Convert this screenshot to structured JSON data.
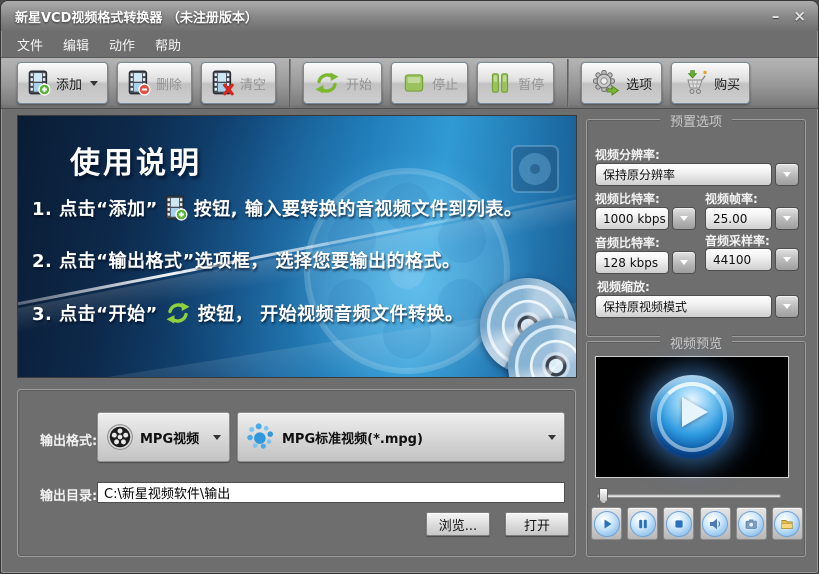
{
  "window": {
    "title": "新星VCD视频格式转换器 （未注册版本）",
    "minimize_glyph": "–",
    "close_glyph": "×"
  },
  "menu": {
    "items": [
      {
        "label": "文件"
      },
      {
        "label": "编辑"
      },
      {
        "label": "动作"
      },
      {
        "label": "帮助"
      }
    ]
  },
  "toolbar": {
    "buttons": [
      {
        "label": "添加",
        "icon": "film-add-icon",
        "enabled": true,
        "has_dropdown": true
      },
      {
        "label": "删除",
        "icon": "film-remove-icon",
        "enabled": false
      },
      {
        "label": "清空",
        "icon": "film-clear-icon",
        "enabled": false
      },
      {
        "label": "开始",
        "icon": "refresh-arrows-icon",
        "enabled": false
      },
      {
        "label": "停止",
        "icon": "stop-square-icon",
        "enabled": false
      },
      {
        "label": "暂停",
        "icon": "pause-bars-icon",
        "enabled": false
      },
      {
        "label": "选项",
        "icon": "gear-icon",
        "enabled": true
      },
      {
        "label": "购买",
        "icon": "shopping-cart-icon",
        "enabled": true
      }
    ]
  },
  "instructions": {
    "title": "使用说明",
    "steps": [
      {
        "pre": "1. 点击“添加”",
        "icon": "film-add-icon",
        "post": "按钮, 输入要转换的音视频文件到列表。"
      },
      {
        "pre": "2. 点击“输出格式”选项框， 选择您要输出的格式。",
        "icon": "",
        "post": ""
      },
      {
        "pre": "3. 点击“开始”",
        "icon": "refresh-arrows-icon",
        "post": "按钮， 开始视频音频文件转换。"
      }
    ]
  },
  "preset_panel": {
    "title": "预置选项",
    "resolution_label": "视频分辨率:",
    "resolution_value": "保持原分辨率",
    "video_bitrate_label": "视频比特率:",
    "video_bitrate_value": "1000 kbps",
    "framerate_label": "视频帧率:",
    "framerate_value": "25.00",
    "audio_bitrate_label": "音频比特率:",
    "audio_bitrate_value": "128 kbps",
    "sample_rate_label": "音频采样率:",
    "sample_rate_value": "44100",
    "scale_label": "视频缩放:",
    "scale_value": "保持原视频模式"
  },
  "preview_panel": {
    "title": "视频预览",
    "player_buttons": [
      {
        "icon": "play-icon"
      },
      {
        "icon": "pause-icon"
      },
      {
        "icon": "stop-icon"
      },
      {
        "icon": "speaker-icon"
      },
      {
        "icon": "snapshot-camera-icon"
      },
      {
        "icon": "open-folder-icon"
      }
    ]
  },
  "output": {
    "format_label": "输出格式:",
    "format_value": "MPG视频",
    "profile_value": "MPG标准视频(*.mpg)",
    "dir_label": "输出目录:",
    "dir_value": "C:\\新星视频软件\\输出",
    "browse_label": "浏览...",
    "open_label": "打开"
  },
  "colors": {
    "window_bg": "#6e6e6e",
    "accent_green": "#7cb82f",
    "hero_blue": "#1a76b2",
    "player_blue": "#2a72b8"
  }
}
